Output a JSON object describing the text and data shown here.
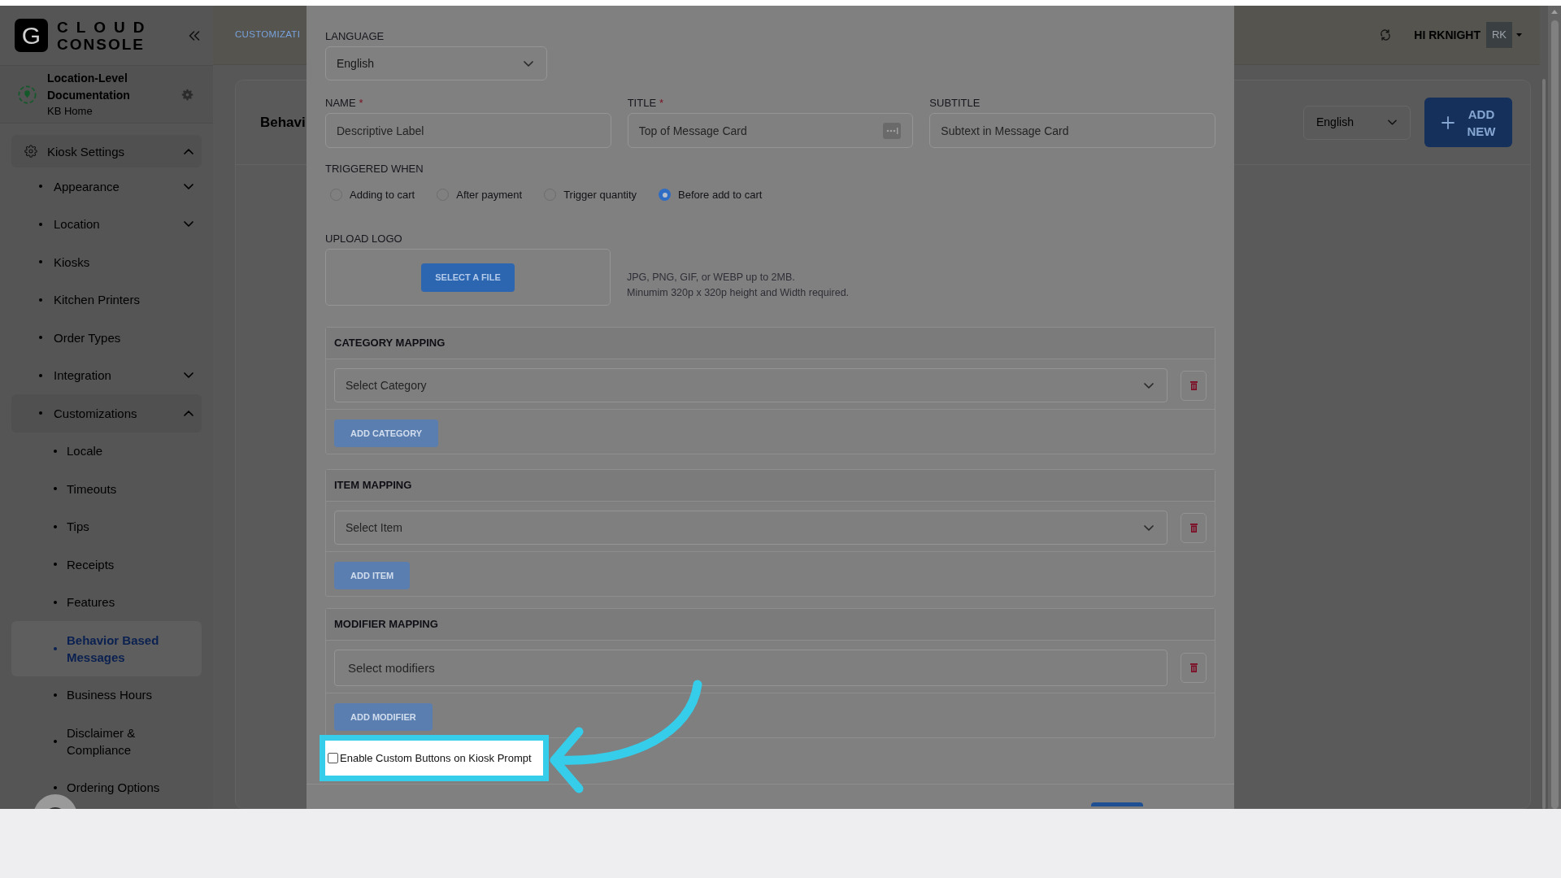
{
  "header": {
    "logo": {
      "letter": "G",
      "line1": "CLOUD",
      "line2": "CONSOLE"
    },
    "breadcrumb": "CUSTOMIZATI",
    "greeting": "HI RKNIGHT",
    "avatar": "RK"
  },
  "location": {
    "name": "Location-Level Documentation",
    "subtitle": "KB Home"
  },
  "sidebar": {
    "items": [
      {
        "label": "Kiosk Settings",
        "expanded": true,
        "selected": false,
        "children": [
          {
            "label": "Appearance",
            "expanded": false,
            "selected": false
          },
          {
            "label": "Location",
            "expanded": false,
            "selected": false
          },
          {
            "label": "Kiosks",
            "selected": false
          },
          {
            "label": "Kitchen Printers",
            "selected": false
          },
          {
            "label": "Order Types",
            "selected": false
          },
          {
            "label": "Integration",
            "expanded": false,
            "selected": false
          },
          {
            "label": "Customizations",
            "expanded": true,
            "selected": false,
            "children": [
              {
                "label": "Locale",
                "selected": false
              },
              {
                "label": "Timeouts",
                "selected": false
              },
              {
                "label": "Tips",
                "selected": false
              },
              {
                "label": "Receipts",
                "selected": false
              },
              {
                "label": "Features",
                "selected": false
              },
              {
                "label": "Behavior Based Messages",
                "selected": true
              },
              {
                "label": "Business Hours",
                "selected": false
              },
              {
                "label": "Disclaimer & Compliance",
                "selected": false
              },
              {
                "label": "Ordering Options",
                "selected": false
              }
            ]
          }
        ]
      }
    ]
  },
  "page": {
    "title": "Behavi",
    "language": "English",
    "add_button": "ADD NEW"
  },
  "modal": {
    "language": {
      "label": "LANGUAGE",
      "value": "English"
    },
    "fields": [
      {
        "label": "NAME",
        "required_mark": "*",
        "kind": "text",
        "placeholder": "Descriptive Label"
      },
      {
        "label": "TITLE",
        "required_mark": "*",
        "kind": "with-button",
        "placeholder": "Top of Message Card"
      },
      {
        "label": "SUBTITLE",
        "kind": "text",
        "placeholder": "Subtext in Message Card"
      }
    ],
    "trigger": {
      "label": "TRIGGERED WHEN",
      "options": [
        {
          "label": "Adding to cart",
          "selected": false
        },
        {
          "label": "After payment",
          "selected": false
        },
        {
          "label": "Trigger quantity",
          "selected": false
        },
        {
          "label": "Before add to cart",
          "selected": true
        }
      ]
    },
    "upload": {
      "label": "UPLOAD LOGO",
      "button": "SELECT A FILE",
      "hints": [
        "JPG, PNG, GIF, or WEBP up to 2MB.",
        "Minumim 320p x 320p height and Width required."
      ]
    },
    "mappings": [
      {
        "title": "CATEGORY MAPPING",
        "kind": "dropdown",
        "placeholder": "Select Category",
        "button": "ADD CATEGORY"
      },
      {
        "title": "ITEM MAPPING",
        "kind": "dropdown",
        "placeholder": "Select Item",
        "button": "ADD ITEM"
      },
      {
        "title": "MODIFIER MAPPING",
        "kind": "multiselect",
        "placeholder": "Select modifiers",
        "button": "ADD MODIFIER"
      }
    ],
    "checkbox": {
      "label": "Enable Custom Buttons on Kiosk Prompt",
      "checked": false
    }
  }
}
